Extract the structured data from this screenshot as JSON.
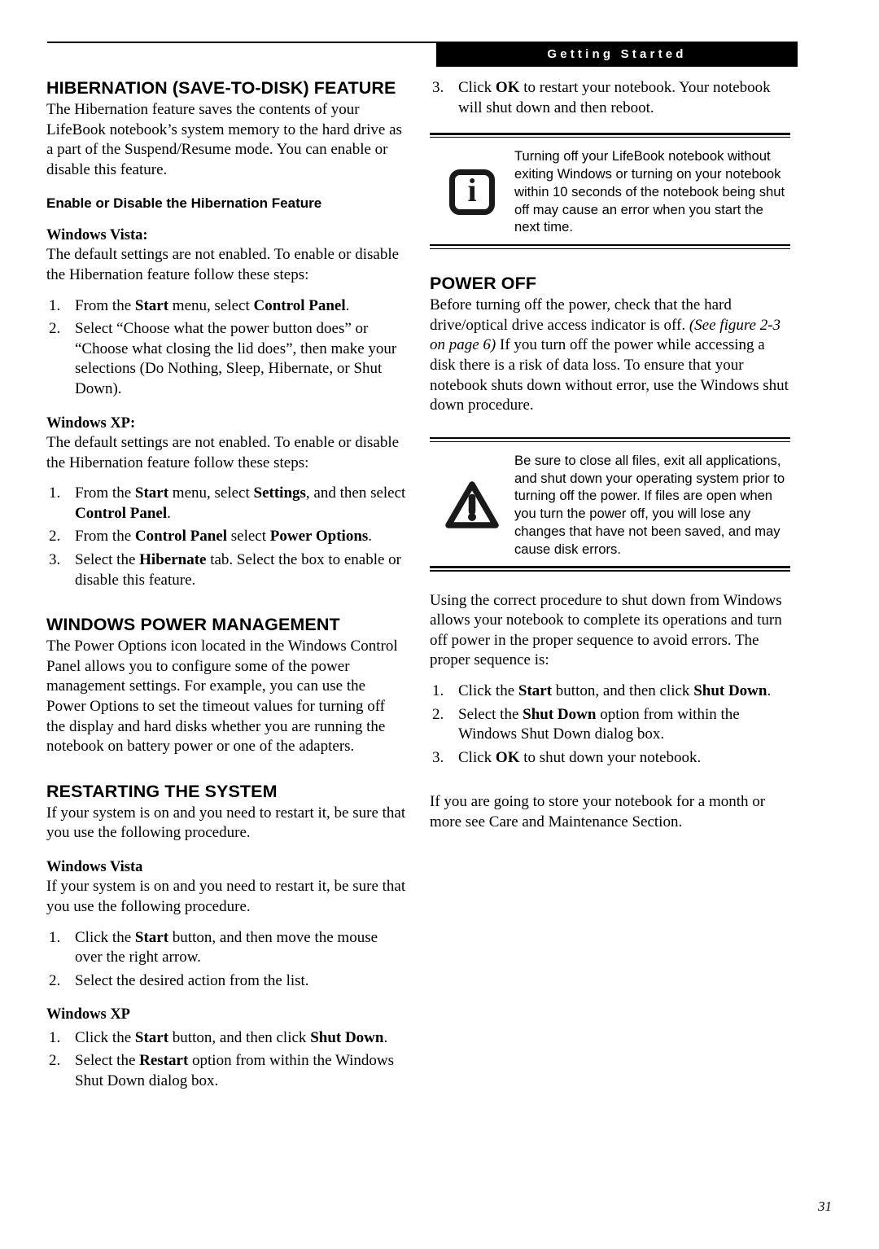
{
  "running_head": {
    "banner_text": "Getting Started"
  },
  "footer": {
    "page_number": "31"
  },
  "left_column": {
    "hibernation": {
      "heading": "HIBERNATION (SAVE-TO-DISK) FEATURE",
      "intro": "The Hibernation feature saves the contents of your LifeBook notebook’s system memory to the hard drive as a part of the Suspend/Resume mode. You can enable or disable this feature.",
      "subheading": "Enable or Disable the Hibernation Feature",
      "vista_label": "Windows Vista:",
      "vista_intro": "The default settings are not enabled. To enable or disable the Hibernation feature follow these steps:",
      "vista_steps": [
        {
          "num": "1.",
          "text_html": "From the <b>Start</b> menu, select <b>Control Panel</b>."
        },
        {
          "num": "2.",
          "text_html": "Select “Choose what the power button does” or “Choose what closing the lid does”, then make your selections (Do Nothing, Sleep, Hibernate, or Shut Down)."
        }
      ],
      "xp_label": "Windows XP:",
      "xp_intro": "The default settings are not enabled. To enable or disable the Hibernation feature follow these steps:",
      "xp_steps": [
        {
          "num": "1.",
          "text_html": "From the <b>Start</b> menu, select <b>Settings</b>, and then select <b>Control Panel</b>."
        },
        {
          "num": "2.",
          "text_html": "From the <b>Control Panel</b> select <b>Power Options</b>."
        },
        {
          "num": "3.",
          "text_html": "Select the <b>Hibernate</b> tab. Select the box to enable or disable this feature."
        }
      ]
    },
    "power_management": {
      "heading": "WINDOWS POWER MANAGEMENT",
      "body": "The Power Options icon located in the Windows Control Panel allows you to configure some of the power management settings. For example, you can use the Power Options to set the timeout values for turning off the display and hard disks whether you are running the notebook on battery power or one of the adapters."
    },
    "restarting": {
      "heading": "RESTARTING THE SYSTEM",
      "intro": "If your system is on and you need to restart it, be sure that you use the following procedure.",
      "vista_label": "Windows Vista",
      "vista_intro": "If your system is on and you need to restart it, be sure that you use the following procedure.",
      "vista_steps": [
        {
          "num": "1.",
          "text_html": "Click the <b>Start</b> button, and then move the mouse over the right arrow."
        },
        {
          "num": "2.",
          "text_html": "Select the desired action from the list."
        }
      ],
      "xp_label": "Windows XP",
      "xp_steps": [
        {
          "num": "1.",
          "text_html": "Click the <b>Start</b> button, and then click <b>Shut Down</b>."
        },
        {
          "num": "2.",
          "text_html": "Select the <b>Restart</b> option from within the Windows Shut Down dialog box."
        }
      ]
    }
  },
  "right_column": {
    "continued_steps": [
      {
        "num": "3.",
        "text_html": "Click <b>OK</b> to restart your notebook. Your notebook will shut down and then reboot."
      }
    ],
    "info_note": {
      "icon": "info-icon",
      "text": "Turning off your LifeBook notebook without exiting Windows or turning on your notebook within 10 seconds of the notebook being shut off may cause an error when you start the next time."
    },
    "power_off": {
      "heading": "POWER OFF",
      "body_html": "Before turning off the power, check that the hard drive/optical drive access indicator is off. <i>(See figure 2-3 on page 6)</i> If you turn off the power while accessing a disk there is a risk of data loss. To ensure that your notebook shuts down without error, use the Windows shut down procedure."
    },
    "caution_note": {
      "icon": "warning-triangle-icon",
      "text": "Be sure to close all files, exit all applications, and shut down your operating system prior to turning off the power. If files are open when you turn the power off, you will lose any changes that have not been saved, and may cause disk errors."
    },
    "shutdown": {
      "intro": "Using the correct procedure to shut down from Windows allows your notebook to complete its operations and turn off power in the proper sequence to avoid errors. The proper sequence is:",
      "steps": [
        {
          "num": "1.",
          "text_html": "Click the <b>Start</b> button, and then click <b>Shut Down</b>."
        },
        {
          "num": "2.",
          "text_html": "Select the <b>Shut Down</b> option from within the Windows Shut Down dialog box."
        },
        {
          "num": "3.",
          "text_html": "Click <b>OK</b> to shut down your notebook."
        }
      ],
      "closing": "If you are going to store your notebook for a month or more see Care and Maintenance Section."
    }
  }
}
